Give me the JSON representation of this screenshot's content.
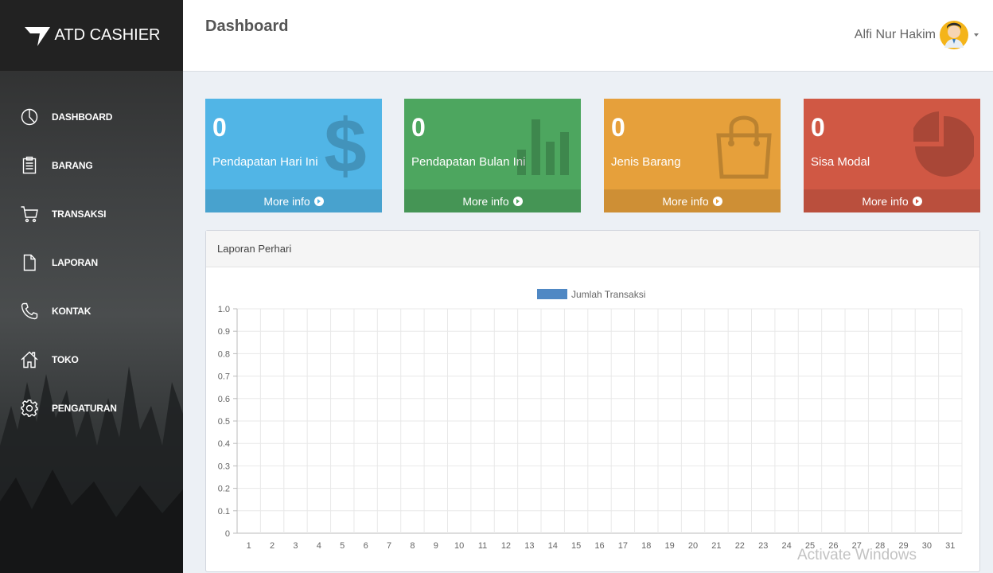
{
  "brand": {
    "name": "ATD CASHIER"
  },
  "sidebar": {
    "items": [
      {
        "label": "DASHBOARD",
        "icon": "pie-chart-icon"
      },
      {
        "label": "BARANG",
        "icon": "clipboard-icon"
      },
      {
        "label": "TRANSAKSI",
        "icon": "cart-icon"
      },
      {
        "label": "LAPORAN",
        "icon": "file-icon"
      },
      {
        "label": "KONTAK",
        "icon": "phone-icon"
      },
      {
        "label": "TOKO",
        "icon": "home-icon"
      },
      {
        "label": "PENGATURAN",
        "icon": "gear-icon"
      }
    ]
  },
  "header": {
    "title": "Dashboard",
    "user_name": "Alfi Nur Hakim"
  },
  "boxes": [
    {
      "value": "0",
      "label": "Pendapatan Hari Ini",
      "footer": "More info",
      "color": "#51b5e6",
      "icon": "dollar-icon"
    },
    {
      "value": "0",
      "label": "Pendapatan Bulan Ini",
      "footer": "More info",
      "color": "#4da65f",
      "icon": "bar-chart-icon"
    },
    {
      "value": "0",
      "label": "Jenis Barang",
      "footer": "More info",
      "color": "#e6a03b",
      "icon": "shopping-bag-icon"
    },
    {
      "value": "0",
      "label": "Sisa Modal",
      "footer": "More info",
      "color": "#d05844",
      "icon": "pie-chart-icon"
    }
  ],
  "panel": {
    "title": "Laporan Perhari"
  },
  "chart_data": {
    "type": "bar",
    "categories": [
      "1",
      "2",
      "3",
      "4",
      "5",
      "6",
      "7",
      "8",
      "9",
      "10",
      "11",
      "12",
      "13",
      "14",
      "15",
      "16",
      "17",
      "18",
      "19",
      "20",
      "21",
      "22",
      "23",
      "24",
      "25",
      "26",
      "27",
      "28",
      "29",
      "30",
      "31"
    ],
    "series": [
      {
        "name": "Jumlah Transaksi",
        "values": [
          0,
          0,
          0,
          0,
          0,
          0,
          0,
          0,
          0,
          0,
          0,
          0,
          0,
          0,
          0,
          0,
          0,
          0,
          0,
          0,
          0,
          0,
          0,
          0,
          0,
          0,
          0,
          0,
          0,
          0,
          0
        ],
        "color": "#4f88c4"
      }
    ],
    "yticks": [
      "0",
      "0.1",
      "0.2",
      "0.3",
      "0.4",
      "0.5",
      "0.6",
      "0.7",
      "0.8",
      "0.9",
      "1.0"
    ],
    "ylim": [
      0,
      1
    ],
    "grid": true,
    "legend_position": "top-center"
  },
  "watermark": "Activate Windows"
}
